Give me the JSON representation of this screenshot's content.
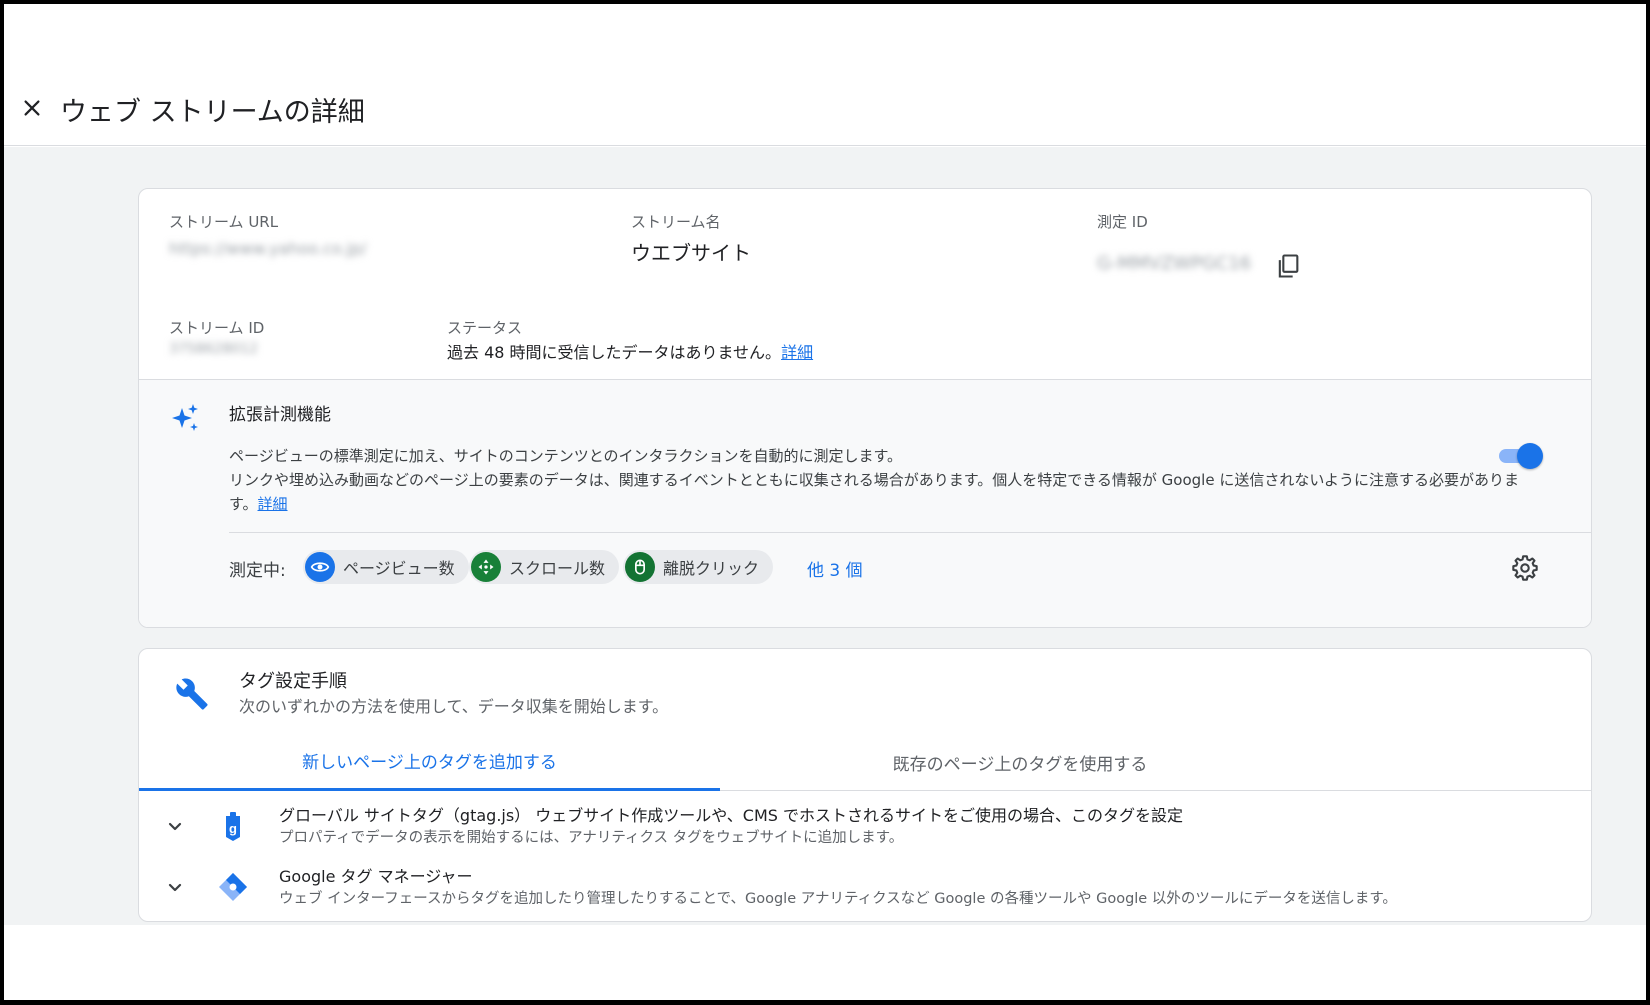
{
  "header": {
    "title": "ウェブ ストリームの詳細"
  },
  "stream": {
    "url_label": "ストリーム URL",
    "url_value": "https://www.yahoo.co.jp/",
    "name_label": "ストリーム名",
    "name_value": "ウエブサイト",
    "measurement_id_label": "測定 ID",
    "measurement_id_value": "G-MMVZWPGC16",
    "stream_id_label": "ストリーム ID",
    "stream_id_value": "3758628012",
    "status_label": "ステータス",
    "status_text": "過去 48 時間に受信したデータはありません。",
    "status_link": "詳細"
  },
  "enhanced": {
    "title": "拡張計測機能",
    "desc_line1": "ページビューの標準測定に加え、サイトのコンテンツとのインタラクションを自動的に測定します。",
    "desc_line2": "リンクや埋め込み動画などのページ上の要素のデータは、関連するイベントとともに収集される場合があります。個人を特定できる情報が Google に送信されないように注意する必要があります。",
    "desc_link": "詳細",
    "toggle_on": true,
    "measuring_label": "測定中:",
    "chips": [
      {
        "label": "ページビュー数",
        "icon": "eye-icon",
        "color": "#1a73e8"
      },
      {
        "label": "スクロール数",
        "icon": "crosshair-icon",
        "color": "#188038"
      },
      {
        "label": "離脱クリック",
        "icon": "mouse-icon",
        "color": "#137333"
      }
    ],
    "more_link": "他 3 個"
  },
  "tagging": {
    "title": "タグ設定手順",
    "subtitle": "次のいずれかの方法を使用して、データ収集を開始します。",
    "tabs": [
      {
        "label": "新しいページ上のタグを追加する",
        "active": true
      },
      {
        "label": "既存のページ上のタグを使用する",
        "active": false
      }
    ],
    "rows": [
      {
        "icon": "gtag-icon",
        "title": "グローバル サイトタグ（gtag.js） ウェブサイト作成ツールや、CMS でホストされるサイトをご使用の場合、このタグを設定",
        "subtitle": "プロパティでデータの表示を開始するには、アナリティクス タグをウェブサイトに追加します。"
      },
      {
        "icon": "tag-manager-icon",
        "title": "Google タグ マネージャー",
        "subtitle": "ウェブ インターフェースからタグを追加したり管理したりすることで、Google アナリティクスなど Google の各種ツールや Google 以外のツールにデータを送信します。"
      }
    ]
  },
  "colors": {
    "accent": "#1a73e8",
    "background": "#f1f3f4",
    "card_border": "#dadce0"
  }
}
